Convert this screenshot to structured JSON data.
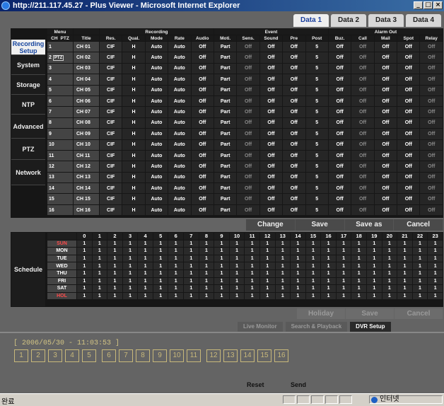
{
  "window": {
    "title": "http://211.117.45.27 - Plus Viewer - Microsoft Internet Explorer"
  },
  "tabs": [
    "Data 1",
    "Data 2",
    "Data 3",
    "Data 4"
  ],
  "nav": [
    "Recording Setup",
    "System",
    "Storage",
    "NTP",
    "Advanced",
    "PTZ",
    "Network"
  ],
  "headers": {
    "menu": "Menu",
    "ch": "CH",
    "ptz": "PTZ",
    "title": "Title",
    "recording": "Recording",
    "event": "Event",
    "alarm_out": "Alarm Out",
    "rec_cols": [
      "Res.",
      "Qual.",
      "Mode",
      "Rate",
      "Audio"
    ],
    "event_cols": [
      "Moti.",
      "Sens.",
      "Sound",
      "Pre",
      "Post"
    ],
    "alarm_cols": [
      "Buz.",
      "Call",
      "Mail",
      "Spot",
      "Relay"
    ]
  },
  "ptz_tag": "PTZ",
  "channels": [
    {
      "ch": "1",
      "title": "CH 01"
    },
    {
      "ch": "2",
      "title": "CH 02"
    },
    {
      "ch": "3",
      "title": "CH 03"
    },
    {
      "ch": "4",
      "title": "CH 04"
    },
    {
      "ch": "5",
      "title": "CH 05"
    },
    {
      "ch": "6",
      "title": "CH 06"
    },
    {
      "ch": "7",
      "title": "CH 07"
    },
    {
      "ch": "8",
      "title": "CH 08"
    },
    {
      "ch": "9",
      "title": "CH 09"
    },
    {
      "ch": "10",
      "title": "CH 10"
    },
    {
      "ch": "11",
      "title": "CH 11"
    },
    {
      "ch": "12",
      "title": "CH 12"
    },
    {
      "ch": "13",
      "title": "CH 13"
    },
    {
      "ch": "14",
      "title": "CH 14"
    },
    {
      "ch": "15",
      "title": "CH 15"
    },
    {
      "ch": "16",
      "title": "CH 16"
    }
  ],
  "row_values": [
    "CIF",
    "H",
    "Auto",
    "Auto",
    "Off",
    "Part",
    "Off",
    "Off",
    "Off",
    "5",
    "Off",
    "Off",
    "Off",
    "Off",
    "Off"
  ],
  "actions": [
    "Change",
    "Save",
    "Save as",
    "Cancel"
  ],
  "schedule": {
    "label": "Schedule",
    "hours": [
      "0",
      "1",
      "2",
      "3",
      "4",
      "5",
      "6",
      "7",
      "8",
      "9",
      "10",
      "11",
      "12",
      "13",
      "14",
      "15",
      "16",
      "17",
      "18",
      "19",
      "20",
      "21",
      "22",
      "23"
    ],
    "days": [
      "SUN",
      "MON",
      "TUE",
      "WED",
      "THU",
      "FRI",
      "SAT",
      "HOL"
    ],
    "cell": "1"
  },
  "schedule_actions": [
    "Holiday",
    "Save",
    "Cancel"
  ],
  "bottom_tabs": [
    "Live Monitor",
    "Search & Playback",
    "DVR Setup"
  ],
  "datetime": "[ 2006/05/30 - 11:03:53 ]",
  "cameras": [
    "1",
    "2",
    "3",
    "4",
    "5",
    "6",
    "7",
    "8",
    "9",
    "10",
    "11",
    "12",
    "13",
    "14",
    "15",
    "16"
  ],
  "links": {
    "reset": "Reset",
    "send": "Send"
  },
  "statusbar": {
    "left": "완료",
    "right": "인터넷"
  }
}
